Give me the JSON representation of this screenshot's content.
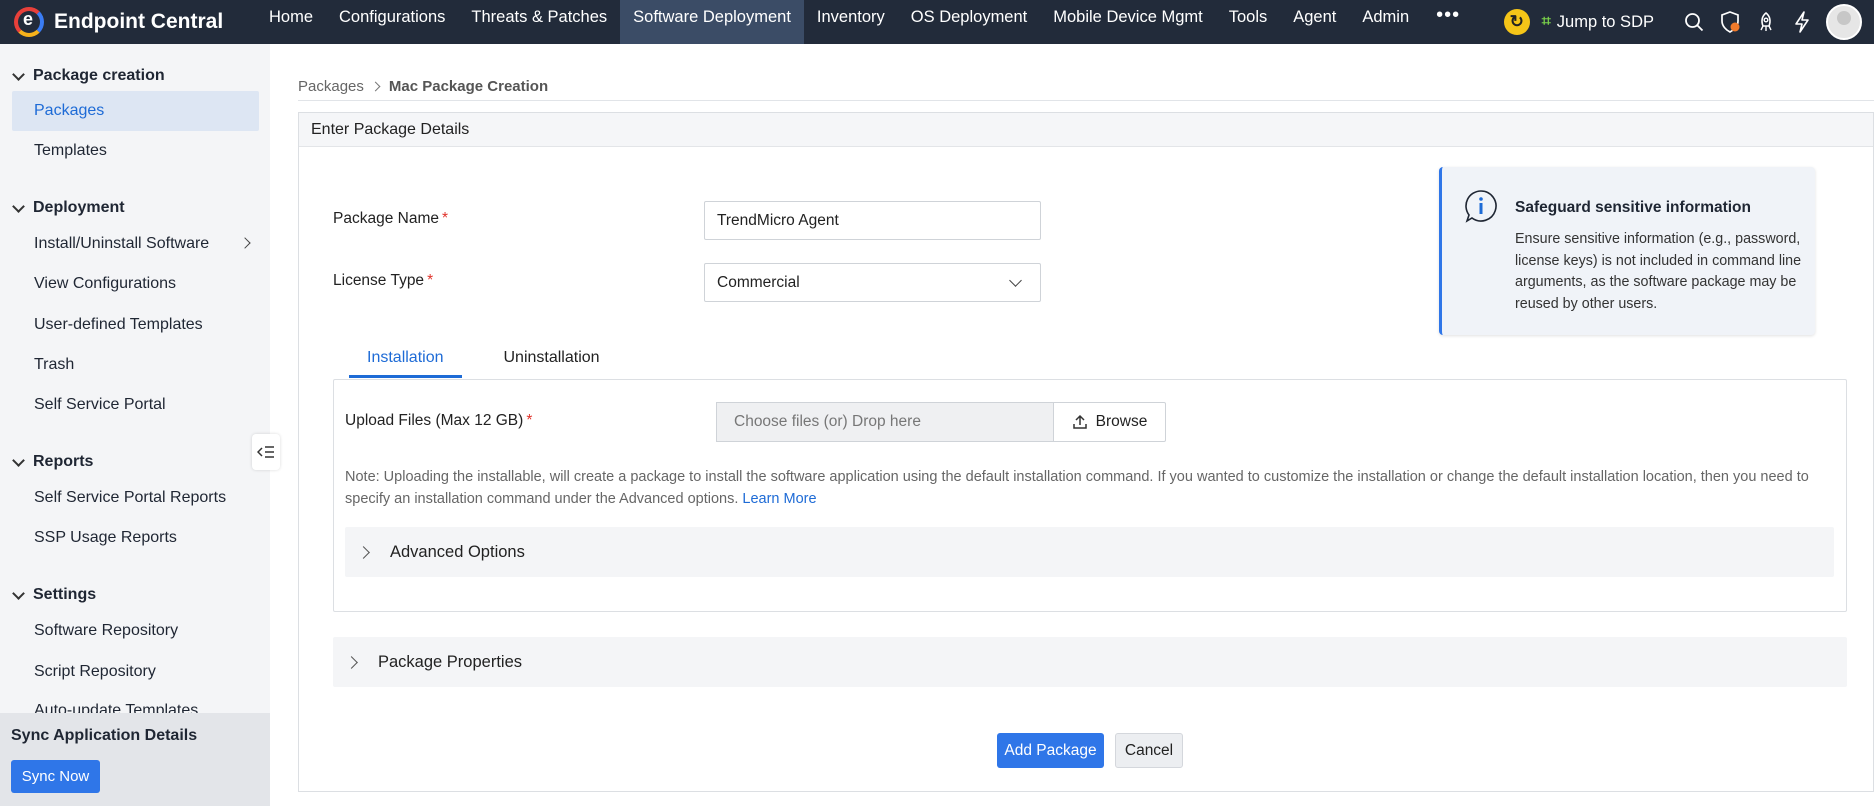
{
  "app": {
    "name": "Endpoint Central"
  },
  "nav": {
    "items": [
      "Home",
      "Configurations",
      "Threats & Patches",
      "Software Deployment",
      "Inventory",
      "OS Deployment",
      "Mobile Device Mgmt",
      "Tools",
      "Agent",
      "Admin"
    ],
    "active": "Software Deployment",
    "more": "•••",
    "jump_label": "Jump to SDP"
  },
  "sidebar": {
    "sections": [
      {
        "title": "Package creation",
        "items": [
          "Packages",
          "Templates"
        ]
      },
      {
        "title": "Deployment",
        "items": [
          "Install/Uninstall Software",
          "View Configurations",
          "User-defined Templates",
          "Trash",
          "Self Service Portal"
        ]
      },
      {
        "title": "Reports",
        "items": [
          "Self Service Portal Reports",
          "SSP Usage Reports"
        ]
      },
      {
        "title": "Settings",
        "items": [
          "Software Repository",
          "Script Repository",
          "Auto-update Templates"
        ]
      }
    ],
    "active_item": "Packages",
    "sync": {
      "title": "Sync Application Details",
      "button": "Sync Now"
    }
  },
  "breadcrumb": {
    "root": "Packages",
    "current": "Mac Package Creation"
  },
  "panel": {
    "title": "Enter Package Details"
  },
  "form": {
    "package_name": {
      "label": "Package Name",
      "required_mark": "*",
      "value": "TrendMicro Agent"
    },
    "license_type": {
      "label": "License Type",
      "required_mark": "*",
      "value": "Commercial"
    }
  },
  "info_card": {
    "title": "Safeguard sensitive information",
    "body": "Ensure sensitive information (e.g., password, license keys) is not included in command line arguments, as the software package may be reused by other users."
  },
  "tabs": {
    "items": [
      "Installation",
      "Uninstallation"
    ],
    "active": "Installation"
  },
  "upload": {
    "label": "Upload Files (Max 12 GB)",
    "required_mark": "*",
    "placeholder": "Choose files (or) Drop here",
    "browse": "Browse",
    "note": "Note: Uploading the installable, will create a package to install the software application using the default installation command. If you wanted to customize the installation or change the default installation location, then you need to specify an installation command under the Advanced options.",
    "learn_more": "Learn More"
  },
  "accordions": {
    "advanced": "Advanced Options",
    "properties": "Package Properties"
  },
  "actions": {
    "primary": "Add Package",
    "secondary": "Cancel"
  },
  "colors": {
    "topbar": "#222b3a",
    "accent": "#2f76e8",
    "required": "#e0322a"
  }
}
